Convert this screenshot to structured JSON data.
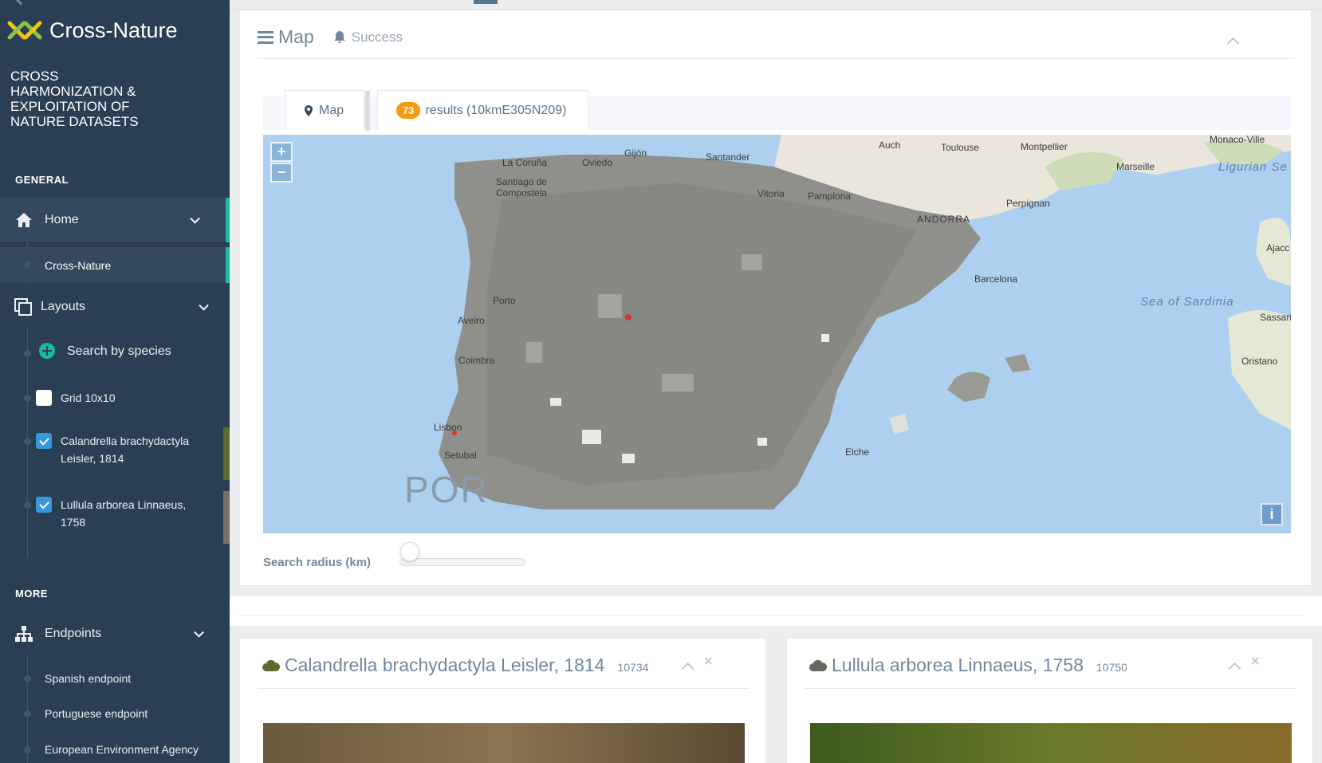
{
  "sidebar": {
    "brand": "Cross-Nature",
    "tagline": "CROSS HARMONIZATION & EXPLOITATION OF NATURE DATASETS",
    "general_title": "GENERAL",
    "more_title": "MORE",
    "home": {
      "label": "Home",
      "icon": "home-icon"
    },
    "home_sub": "Cross-Nature",
    "layouts": {
      "label": "Layouts",
      "icon": "layers-icon"
    },
    "layout_items": [
      {
        "label": "Search by species",
        "icon": "plus-circle-icon"
      },
      {
        "label": "Grid 10x10",
        "checked": false
      },
      {
        "label": "Calandrella brachydactyla Leisler, 1814",
        "checked": true,
        "color": "#5e6b2e"
      },
      {
        "label": "Lullula arborea Linnaeus, 1758",
        "checked": true,
        "color": "#7a6f66"
      }
    ],
    "endpoints": {
      "label": "Endpoints",
      "icon": "sitemap-icon"
    },
    "endpoint_items": [
      "Spanish endpoint",
      "Portuguese endpoint",
      "European Environment Agency"
    ]
  },
  "map_panel": {
    "title": "Map",
    "status": "Success",
    "tabs": {
      "map_label": "Map",
      "results_count": "73",
      "results_label": "results (10kmE305N209)"
    },
    "search_radius_label": "Search radius (km)",
    "zoom_in": "+",
    "zoom_out": "−",
    "info": "i",
    "place_labels": {
      "coruna": "La Coruña",
      "oviedo": "Oviedo",
      "gijon": "Gijón",
      "santander": "Santander",
      "santiago1": "Santiago de",
      "santiago2": "Compostela",
      "vitoria": "Vitoria",
      "pamplona": "Pamplona",
      "auch": "Auch",
      "toulouse": "Toulouse",
      "montpellier": "Montpellier",
      "monaco": "Monaco-Ville",
      "marseille": "Marseille",
      "perpignan": "Perpignan",
      "andorra": "ANDORRA",
      "barcelona": "Barcelona",
      "ajacc": "Ajacc",
      "sassari": "Sassari",
      "oristano": "Oristano",
      "porto": "Porto",
      "aveiro": "Aveiro",
      "coimbra": "Coimbra",
      "lisbon": "Lisbon",
      "setubal": "Setubal",
      "elche": "Elche",
      "por": "POR"
    },
    "sea_labels": {
      "ligurian": "Ligurian Se",
      "sardinia": "Sea of Sardinia"
    }
  },
  "species_panels": [
    {
      "name": "Calandrella brachydactyla Leisler, 1814",
      "count": "10734",
      "cloud_color": "#5e6b2e"
    },
    {
      "name": "Lullula arborea Linnaeus, 1758",
      "count": "10750",
      "cloud_color": "#6b6560"
    }
  ]
}
